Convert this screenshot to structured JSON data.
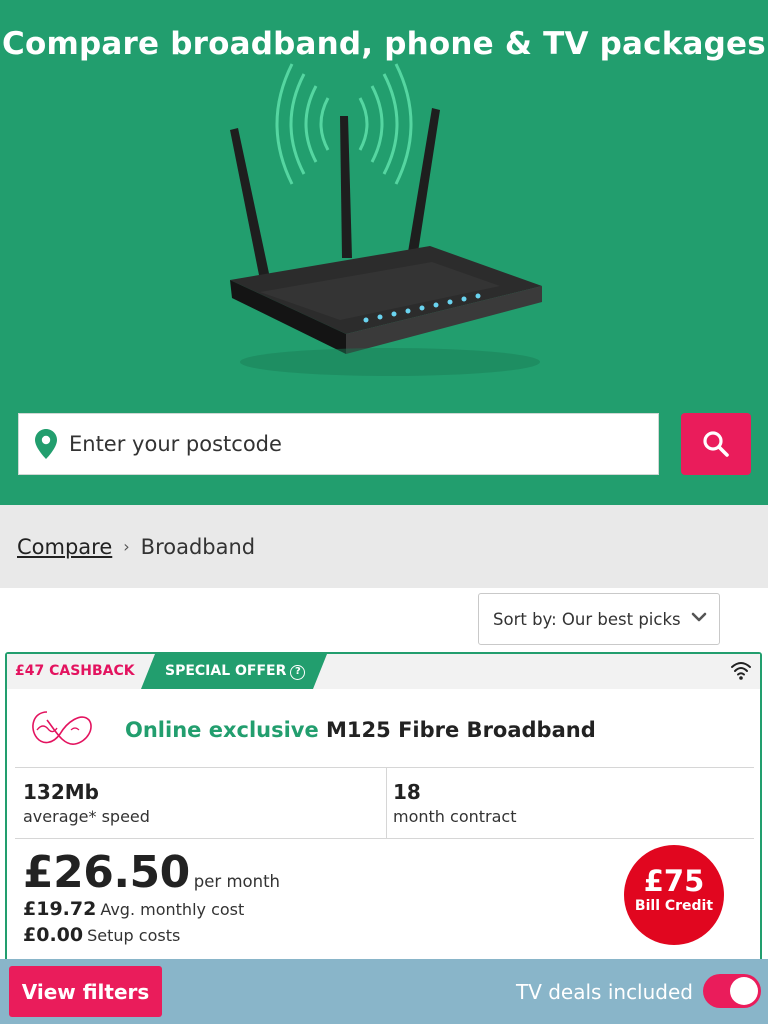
{
  "hero": {
    "title": "Compare broadband, phone & TV packages",
    "image": "router-illustration",
    "background": "#229e6e"
  },
  "search": {
    "placeholder": "Enter your postcode",
    "value": "",
    "icon": "location-pin-icon",
    "button_icon": "search-icon",
    "button_color": "#ea1c5b"
  },
  "breadcrumb": {
    "link": "Compare",
    "separator": "›",
    "current": "Broadband"
  },
  "sort": {
    "label": "Sort by: Our best picks",
    "icon": "chevron-down-icon"
  },
  "deal": {
    "cashback": "£47 CASHBACK",
    "special_offer": "SPECIAL OFFER",
    "help_glyph": "?",
    "type_icon": "wifi-icon",
    "provider_logo": "virgin-media-logo",
    "title_highlight": "Online exclusive",
    "title": "M125 Fibre Broadband",
    "speed_value": "132Mb",
    "speed_label": "average* speed",
    "contract_value": "18",
    "contract_label": "month contract",
    "price": "£26.50",
    "price_period": "per month",
    "avg_cost": "£19.72",
    "avg_cost_label": "Avg. monthly cost",
    "setup_cost": "£0.00",
    "setup_cost_label": "Setup costs",
    "credit_amount": "£75",
    "credit_label": "Bill Credit"
  },
  "bottom_bar": {
    "filters_label": "View filters",
    "tv_toggle_label": "TV deals included",
    "tv_toggle_on": true
  }
}
